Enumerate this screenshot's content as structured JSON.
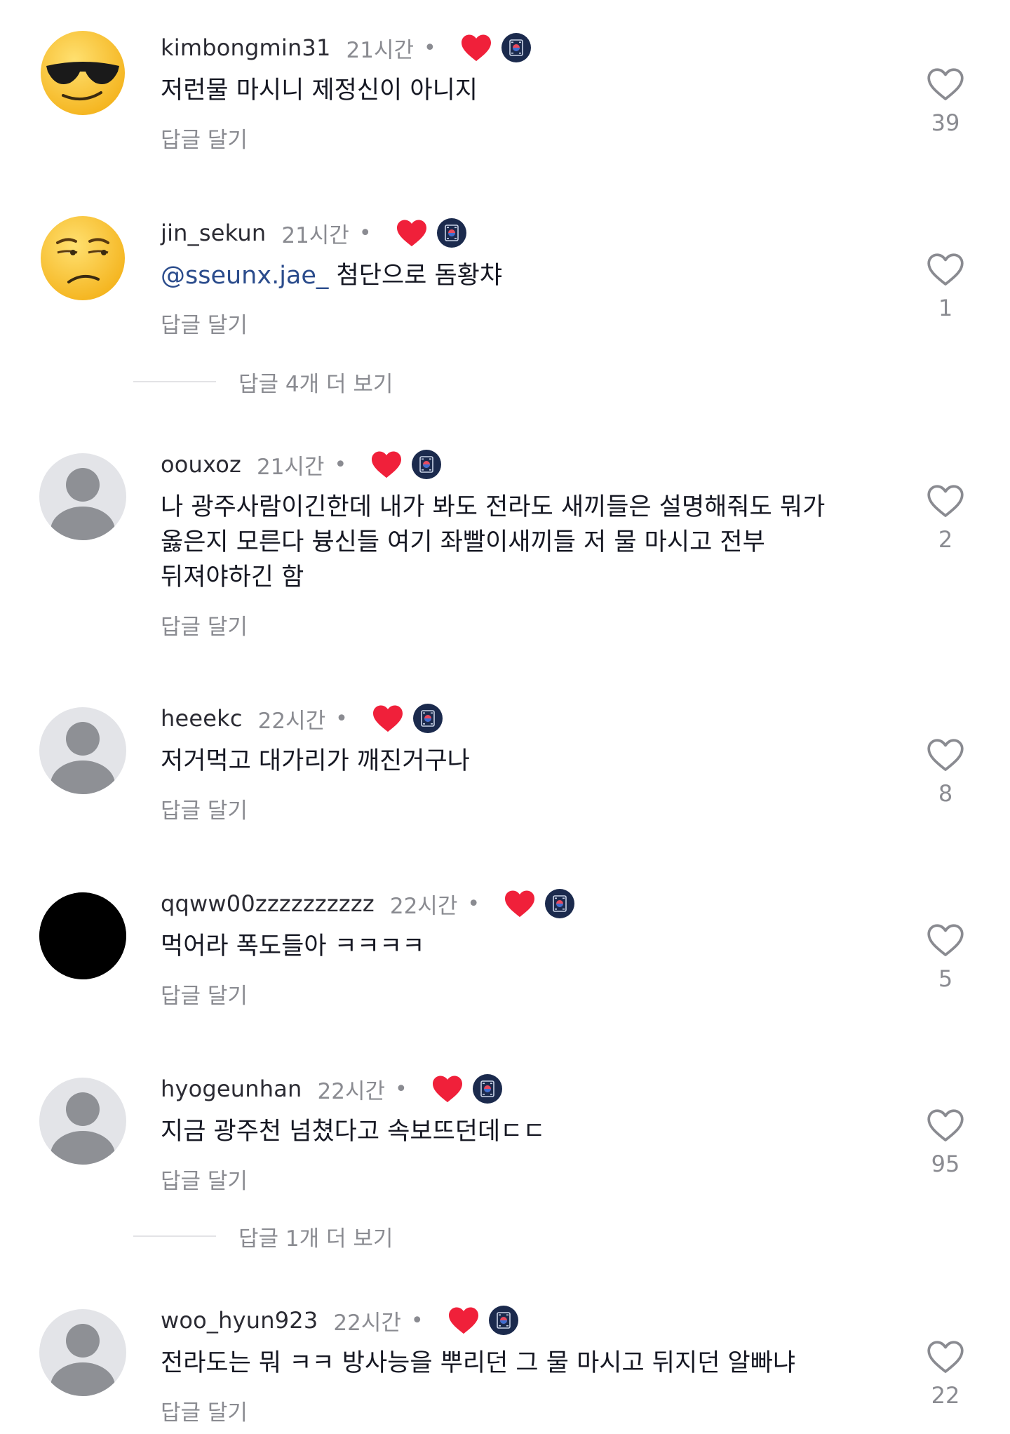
{
  "colors": {
    "username": "#2b2b33",
    "meta_gray": "#8a8b91",
    "mention_blue": "#2b4c8c",
    "reaction_red": "#f0203a",
    "badge_navy": "#1b2a4d",
    "avatar_placeholder_bg": "#e3e4e8",
    "avatar_placeholder_fg": "#8e9095"
  },
  "icons": {
    "reaction": "heart-icon",
    "creator_badge": "badge-icon",
    "like": "heart-outline-icon"
  },
  "comments": [
    {
      "username": "kimbongmin31",
      "time": "21시간",
      "separator": "•",
      "avatar": "sunglasses-emoji-avatar",
      "text": "저런물 마시니 제정신이 아니지",
      "reply_label": "답글 달기",
      "likes": "39"
    },
    {
      "username": "jin_sekun",
      "time": "21시간",
      "separator": "•",
      "avatar": "unamused-emoji-avatar",
      "mention": "@sseunx.jae_",
      "text": " 첨단으로 돔황챠",
      "reply_label": "답글 달기",
      "likes": "1",
      "more_replies": "답글 4개 더 보기"
    },
    {
      "username": "oouxoz",
      "time": "21시간",
      "separator": "•",
      "avatar": "default-avatar",
      "text_lines": [
        "나 광주사람이긴한데 내가 봐도 전라도 새끼들은 설명해줘도 뭐가",
        "옳은지 모른다 븅신들 여기 좌빨이새끼들 저 물 마시고 전부",
        "뒤져야하긴 함"
      ],
      "reply_label": "답글 달기",
      "likes": "2"
    },
    {
      "username": "heeekc",
      "time": "22시간",
      "separator": "•",
      "avatar": "default-avatar",
      "text": "저거먹고 대가리가 깨진거구나",
      "reply_label": "답글 달기",
      "likes": "8"
    },
    {
      "username": "qqww00zzzzzzzzzz",
      "time": "22시간",
      "separator": "•",
      "avatar": "black-avatar",
      "text": "먹어라 폭도들아 ㅋㅋㅋㅋ",
      "reply_label": "답글 달기",
      "likes": "5"
    },
    {
      "username": "hyogeunhan",
      "time": "22시간",
      "separator": "•",
      "avatar": "default-avatar",
      "text": "지금 광주천 넘쳤다고 속보뜨던데ㄷㄷ",
      "reply_label": "답글 달기",
      "likes": "95",
      "more_replies": "답글 1개 더 보기"
    },
    {
      "username": "woo_hyun923",
      "time": "22시간",
      "separator": "•",
      "avatar": "default-avatar",
      "text": "전라도는 뭐 ㅋㅋ 방사능을 뿌리던 그 물 마시고 뒤지던 알빠냐",
      "reply_label": "답글 달기",
      "likes": "22"
    }
  ]
}
